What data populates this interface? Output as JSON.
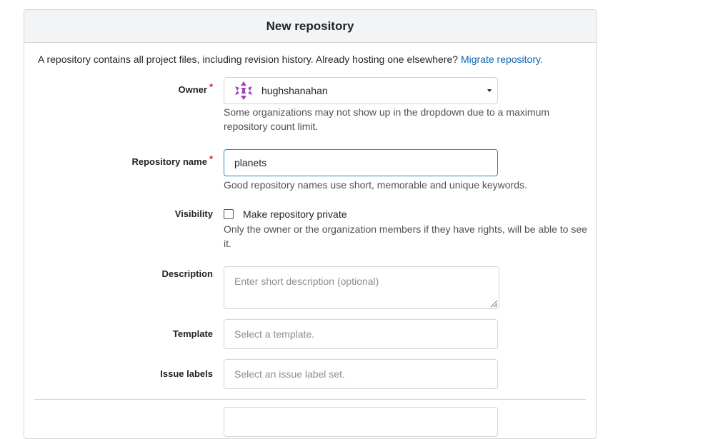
{
  "header": {
    "title": "New repository"
  },
  "intro": {
    "text": "A repository contains all project files, including revision history. Already hosting one elsewhere?",
    "link": "Migrate repository."
  },
  "owner": {
    "label": "Owner",
    "value": "hughshanahan",
    "help": "Some organizations may not show up in the dropdown due to a maximum repository count limit."
  },
  "repo_name": {
    "label": "Repository name",
    "value": "planets",
    "help": "Good repository names use short, memorable and unique keywords."
  },
  "visibility": {
    "label": "Visibility",
    "checkbox_label": "Make repository private",
    "checked": false,
    "help": "Only the owner or the organization members if they have rights, will be able to see it."
  },
  "description": {
    "label": "Description",
    "placeholder": "Enter short description (optional)"
  },
  "template": {
    "label": "Template",
    "placeholder": "Select a template."
  },
  "issue_labels": {
    "label": "Issue labels",
    "placeholder": "Select an issue label set."
  },
  "colors": {
    "required": "#db2828",
    "link": "#0e64b5",
    "focus_border": "#2b8ab0",
    "avatar": "#a040c0"
  }
}
